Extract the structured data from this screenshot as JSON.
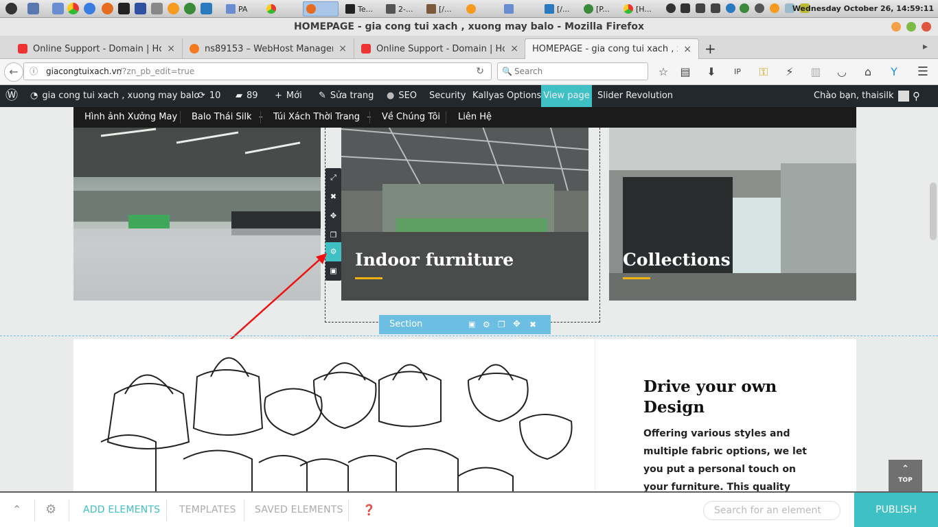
{
  "os_taskbar": {
    "tasks": [
      "PA",
      "Te...",
      "2-...",
      "[/...",
      "[/...",
      "[P...",
      "[H..."
    ],
    "clock": "Wednesday October 26, 14:59:11"
  },
  "browser": {
    "window_title": "HOMEPAGE - gia cong tui xach , xuong may balo - Mozilla Firefox",
    "tabs": [
      {
        "label": "Online Support - Domain | Hosti...",
        "close": "×"
      },
      {
        "label": "ns89153 – WebHost Manager",
        "close": "×"
      },
      {
        "label": "Online Support - Domain | Hosti...",
        "close": "×"
      },
      {
        "label": "HOMEPAGE - gia cong tui xach , xuo...",
        "close": "×"
      }
    ],
    "new_tab": "+",
    "url_domain": "giacongtuixach.vn",
    "url_path": "/?zn_pb_edit=true",
    "search_placeholder": "Search"
  },
  "wp_admin_bar": {
    "site_name": "gia cong tui xach , xuong may balo",
    "updates_count": "10",
    "comments_count": "89",
    "new_label": "Mới",
    "edit_label": "Sửa trang",
    "seo_label": "SEO",
    "security_label": "Security",
    "kallyas_label": "Kallyas Options",
    "view_page_label": "View page",
    "slider_label": "Slider Revolution",
    "greeting": "Chào bạn, thaisilk"
  },
  "site_menu": {
    "items": [
      "Hình ảnh Xưởng May",
      "Balo Thái Silk",
      "Túi Xách Thời Trang",
      "Về Chúng Tôi",
      "Liên Hệ"
    ]
  },
  "cards": [
    {
      "title": ""
    },
    {
      "title": "Indoor furniture"
    },
    {
      "title": "Collections"
    }
  ],
  "section_bar": {
    "label": "Section"
  },
  "feature": {
    "title": "Drive your own Design",
    "text": "Offering various styles and multiple fabric options, we let you put a personal touch on your furniture. This quality collection is"
  },
  "back_to_top": {
    "label": "TOP"
  },
  "page_builder": {
    "add_elements": "ADD ELEMENTS",
    "templates": "TEMPLATES",
    "saved_elements": "SAVED ELEMENTS",
    "search_placeholder": "Search for an element",
    "publish": "PUBLISH"
  },
  "colors": {
    "accent": "#3ec0c4",
    "section_blue": "#6cbfe3",
    "underline": "#f1b10e",
    "admin_bar": "#23282d"
  }
}
